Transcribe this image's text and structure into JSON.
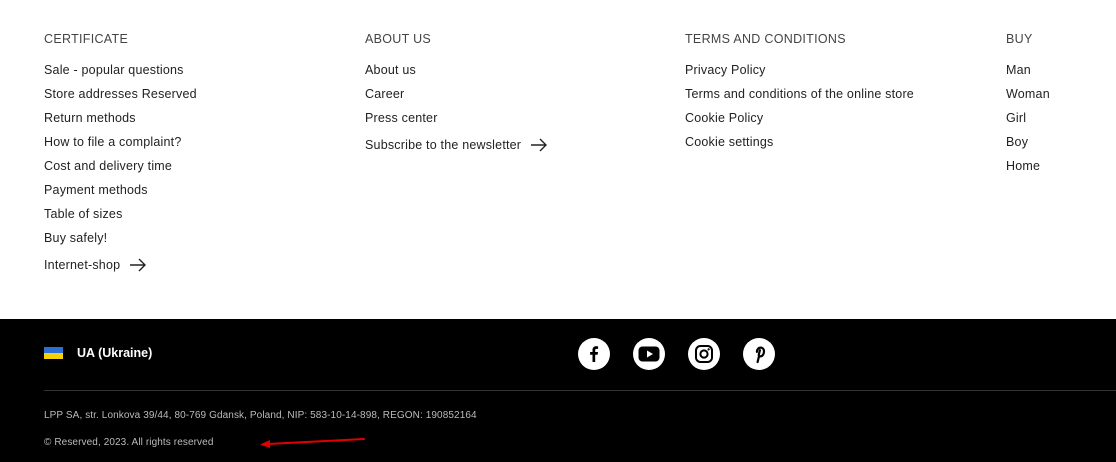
{
  "columns": [
    {
      "title": "CERTIFICATE",
      "links": [
        "Sale - popular questions",
        "Store addresses Reserved",
        "Return methods",
        "How to file a complaint?",
        "Cost and delivery time",
        "Payment methods",
        "Table of sizes",
        "Buy safely!"
      ],
      "arrow_link": "Internet-shop"
    },
    {
      "title": "ABOUT US",
      "links": [
        "About us",
        "Career",
        "Press center"
      ],
      "arrow_link": "Subscribe to the newsletter"
    },
    {
      "title": "TERMS AND CONDITIONS",
      "links": [
        "Privacy Policy",
        "Terms and conditions of the online store",
        "Cookie Policy",
        "Cookie settings"
      ]
    },
    {
      "title": "BUY",
      "links": [
        "Man",
        "Woman",
        "Girl",
        "Boy",
        "Home"
      ]
    }
  ],
  "footer": {
    "country": "UA (Ukraine)",
    "flag_colors": [
      "#2b6fd6",
      "#f4d20a"
    ],
    "socials": [
      "facebook-icon",
      "youtube-icon",
      "instagram-icon",
      "pinterest-icon"
    ],
    "legal": "LPP SA, str. Lonkova 39/44, 80-769 Gdansk, Poland, NIP: 583-10-14-898, REGON: 190852164",
    "copyright": "© Reserved, 2023. All rights reserved"
  },
  "annotation_color": "#e00000"
}
